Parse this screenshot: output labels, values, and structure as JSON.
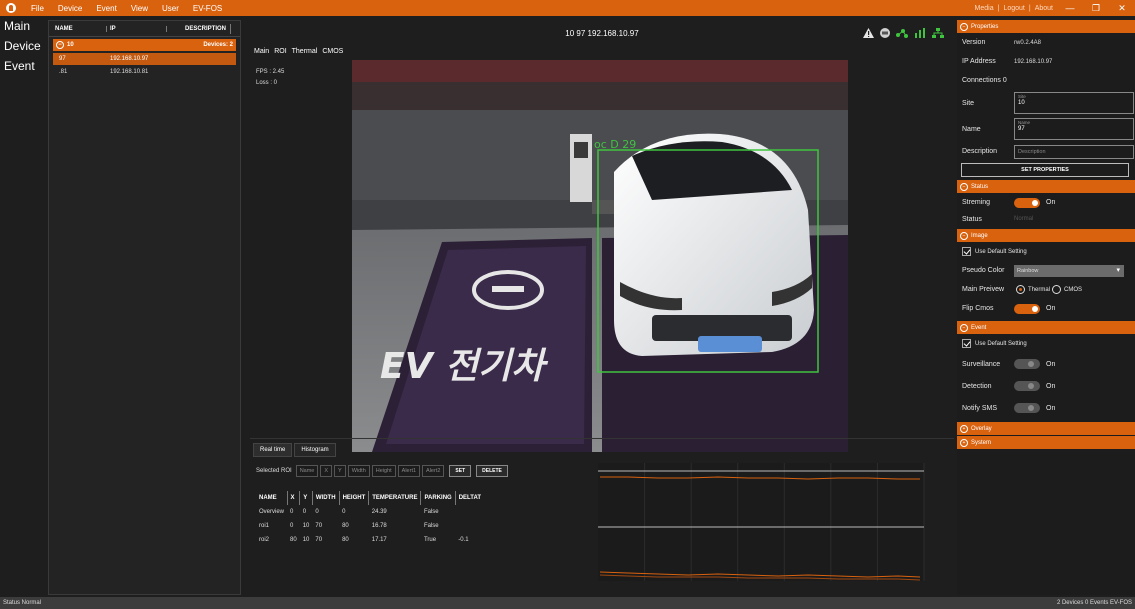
{
  "menubar": {
    "items": [
      "File",
      "Device",
      "Event",
      "View",
      "User",
      "EV-FOS"
    ],
    "right_links": [
      "Media",
      "Logout",
      "About"
    ],
    "window_controls": [
      "—",
      "❐",
      "✕"
    ]
  },
  "leftnav": {
    "items": [
      "Main",
      "Device",
      "Event"
    ]
  },
  "devicelist": {
    "columns": [
      "NAME",
      "IP",
      "DESCRIPTION"
    ],
    "group": {
      "name": "10",
      "count_label": "Devices: 2"
    },
    "rows": [
      {
        "name": "97",
        "ip": "192.168.10.97",
        "selected": true
      },
      {
        "name": ".81",
        "ip": "192.168.10.81",
        "selected": false
      }
    ]
  },
  "center": {
    "camera_title": "10 97 192.168.10.97",
    "view_tabs": [
      "Main",
      "ROI",
      "Thermal",
      "CMOS"
    ],
    "fps": "FPS : 2.45",
    "loss": "Loss : 0",
    "overlay_label": "oc D 29",
    "floor_text": "EV 전기차",
    "icons": [
      "warning-icon",
      "record-icon",
      "share-icon",
      "bar-chart-icon",
      "network-icon"
    ]
  },
  "lower": {
    "tabs": [
      "Real time",
      "Histogram"
    ],
    "roi_label": "Selected ROI",
    "roi_fields": [
      "Name",
      "X",
      "Y",
      "Width",
      "Height",
      "Alert1",
      "Alert2"
    ],
    "set_label": "SET",
    "delete_label": "DELETE",
    "table_columns": [
      "NAME",
      "X",
      "Y",
      "WIDTH",
      "HEIGHT",
      "TEMPERATURE",
      "PARKING",
      "DELTAT"
    ],
    "table_rows": [
      [
        "Overview",
        "0",
        "0",
        "0",
        "0",
        "24.39",
        "False",
        ""
      ],
      [
        "roi1",
        "0",
        "10",
        "70",
        "80",
        "16.78",
        "False",
        ""
      ],
      [
        "roi2",
        "80",
        "10",
        "70",
        "80",
        "17.17",
        "True",
        "-0.1"
      ]
    ]
  },
  "right": {
    "properties": {
      "title": "Properties",
      "version_label": "Version",
      "version": "rw0.2.4A8",
      "ip_label": "IP Address",
      "ip": "192.168.10.97",
      "connections": "Connections  0",
      "site_label": "Site",
      "site_hint": "Site",
      "site": "10",
      "name_label": "Name",
      "name_hint": "Name",
      "name": "97",
      "desc_label": "Description",
      "desc_placeholder": "Description",
      "set_button": "SET PROPERTIES"
    },
    "status": {
      "title": "Status",
      "streaming_label": "Streming",
      "streaming_value": "On",
      "status_label": "Status",
      "status_value": "Normal"
    },
    "image": {
      "title": "Image",
      "default_setting": "Use Default Setting",
      "pseudo_label": "Pseudo Color",
      "pseudo_value": "Rainbow",
      "preview_label": "Main Preivew",
      "preview_thermal": "Thermal",
      "preview_cmos": "CMOS",
      "flip_label": "Flip Cmos",
      "flip_value": "On"
    },
    "event": {
      "title": "Event",
      "default_setting": "Use Default Setting",
      "surveillance_label": "Surveillance",
      "surveillance_value": "On",
      "detection_label": "Detection",
      "detection_value": "On",
      "sms_label": "Notify SMS",
      "sms_value": "On"
    },
    "overlay": {
      "title": "Overlay"
    },
    "system": {
      "title": "System"
    }
  },
  "statusbar": {
    "left": "Status Normal",
    "right": "2 Devices  0 Events  EV-FOS"
  },
  "colors": {
    "accent": "#d9620f",
    "roi_box": "#3fc43f",
    "plate": "#5a8fd6"
  }
}
